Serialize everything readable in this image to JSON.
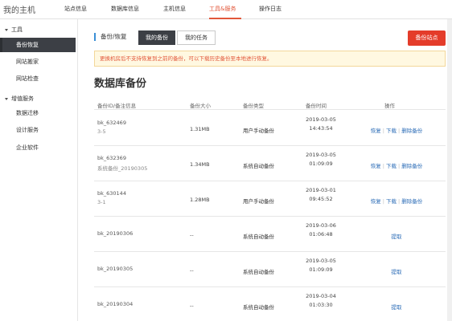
{
  "app": {
    "brand": "我的主机"
  },
  "topnav": {
    "items": [
      {
        "label": "站点信息"
      },
      {
        "label": "数据库信息"
      },
      {
        "label": "主机信息"
      },
      {
        "label": "工具&服务"
      },
      {
        "label": "操作日志"
      }
    ],
    "active_index": 3,
    "accent": "#e2573a"
  },
  "sidebar": {
    "groups": [
      {
        "label": "工具",
        "items": [
          {
            "label": "备份恢复"
          },
          {
            "label": "网站搬家"
          },
          {
            "label": "网站检查"
          }
        ]
      },
      {
        "label": "增值服务",
        "items": [
          {
            "label": "数据迁移"
          },
          {
            "label": "设计服务"
          },
          {
            "label": "企业软件"
          }
        ]
      }
    ],
    "active_item": "备份恢复"
  },
  "main": {
    "section_title": "备份/恢复",
    "tabs": [
      {
        "label": "我的备份"
      },
      {
        "label": "我的任务"
      }
    ],
    "active_tab": "我的备份",
    "backup_button": "备份站点",
    "notice": "更换机房后不支持恢复到之前的备份，可以下载历史备份至本地进行恢复。",
    "page_title": "数据库备份"
  },
  "table": {
    "headers": {
      "id": "备份ID/备注信息",
      "size": "备份大小",
      "type": "备份类型",
      "time": "备份时间",
      "ops": "操作"
    },
    "rows": [
      {
        "id": "bk_632469",
        "note": "3-5",
        "size": "1.31MB",
        "type": "用户手动备份",
        "date": "2019-03-05",
        "clock": "14:43:54",
        "ops": [
          "恢复",
          "下载",
          "删除备份"
        ]
      },
      {
        "id": "bk_632369",
        "note": "系统备份_20190305",
        "size": "1.34MB",
        "type": "系统自动备份",
        "date": "2019-03-05",
        "clock": "01:09:09",
        "ops": [
          "恢复",
          "下载",
          "删除备份"
        ]
      },
      {
        "id": "bk_630144",
        "note": "3-1",
        "size": "1.28MB",
        "type": "用户手动备份",
        "date": "2019-03-01",
        "clock": "09:45:52",
        "ops": [
          "恢复",
          "下载",
          "删除备份"
        ]
      },
      {
        "id": "bk_20190306",
        "note": "",
        "size": "--",
        "type": "系统自动备份",
        "date": "2019-03-06",
        "clock": "01:06:48",
        "ops": [
          "提取"
        ]
      },
      {
        "id": "bk_20190305",
        "note": "",
        "size": "--",
        "type": "系统自动备份",
        "date": "2019-03-05",
        "clock": "01:09:09",
        "ops": [
          "提取"
        ]
      },
      {
        "id": "bk_20190304",
        "note": "",
        "size": "--",
        "type": "系统自动备份",
        "date": "2019-03-04",
        "clock": "01:03:30",
        "ops": [
          "提取"
        ]
      }
    ]
  }
}
